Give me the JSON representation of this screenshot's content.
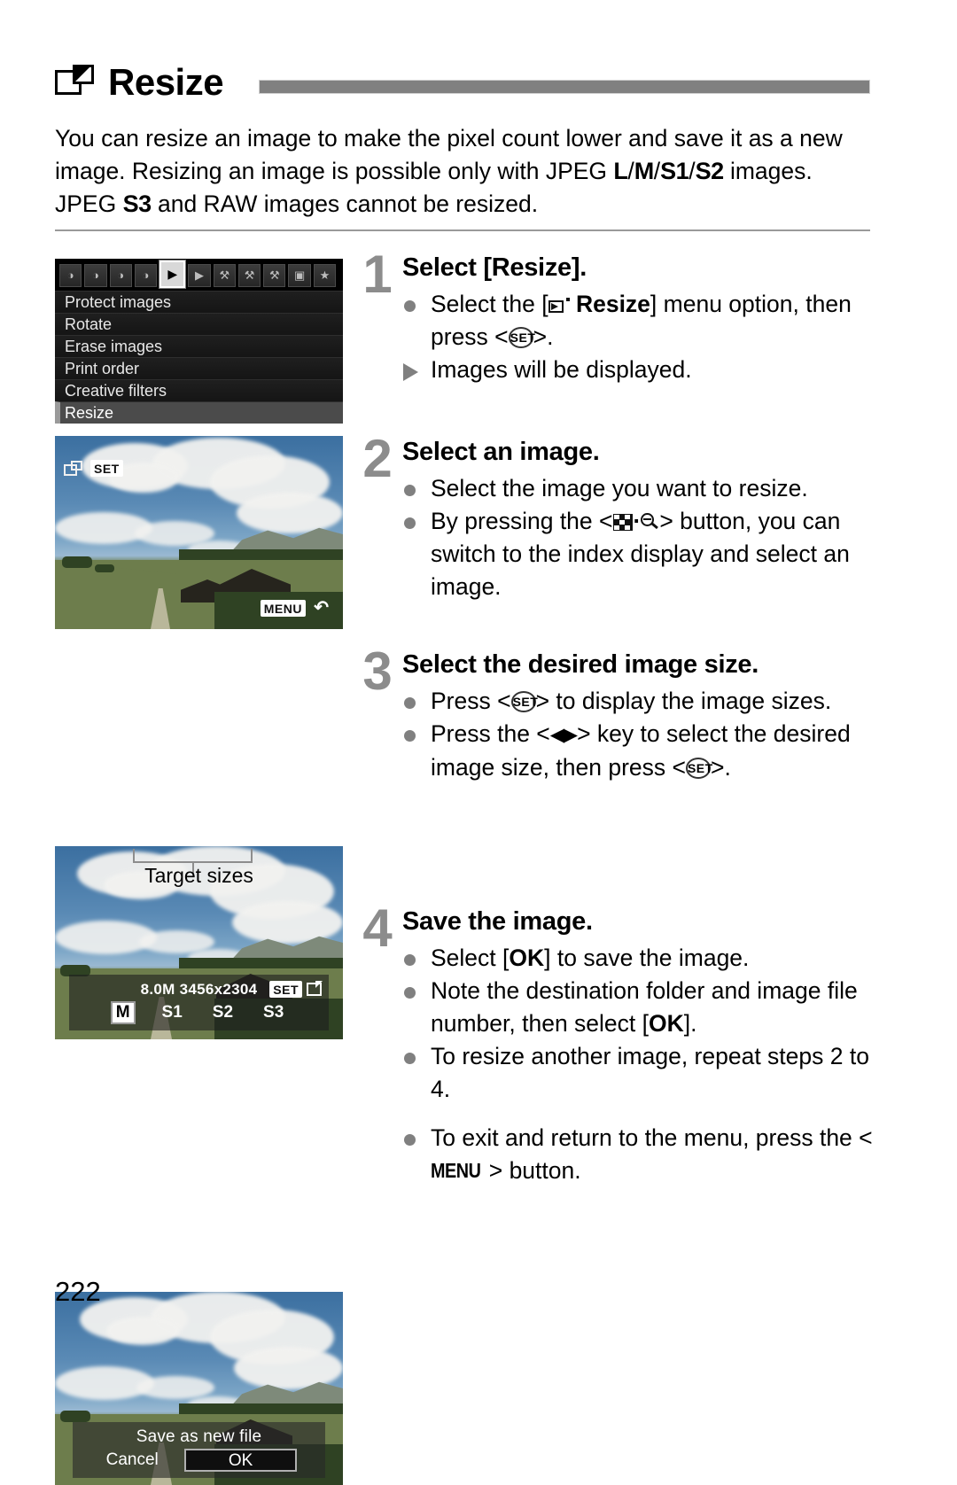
{
  "page": {
    "title": "Resize",
    "title_icon": "resize-icon",
    "number": "222",
    "intro_part1": "You can resize an image to make the pixel count lower and save it as a new image. Resizing an image is possible only with JPEG ",
    "intro_sizes_a": "L",
    "intro_sep1": "/",
    "intro_sizes_b": "M",
    "intro_sep2": "/",
    "intro_sizes_c": "S1",
    "intro_sep3": "/",
    "intro_sizes_d": "S2",
    "intro_part2": " images. JPEG ",
    "intro_sizes_e": "S3",
    "intro_part3": " and RAW images cannot be resized."
  },
  "menu_screen": {
    "tabs": [
      {
        "name": "shooting-tab-1",
        "glyph": "◑",
        "selected": false
      },
      {
        "name": "shooting-tab-2",
        "glyph": "◑",
        "selected": false
      },
      {
        "name": "shooting-tab-3",
        "glyph": "◑",
        "selected": false
      },
      {
        "name": "shooting-tab-4",
        "glyph": "◑",
        "selected": false
      },
      {
        "name": "playback-tab-1",
        "glyph": "▶",
        "selected": true
      },
      {
        "name": "playback-tab-2",
        "glyph": "▶",
        "selected": false
      },
      {
        "name": "setup-tab-1",
        "glyph": "⚒",
        "selected": false
      },
      {
        "name": "setup-tab-2",
        "glyph": "⚒",
        "selected": false
      },
      {
        "name": "setup-tab-3",
        "glyph": "⚒",
        "selected": false
      },
      {
        "name": "custom-functions-tab",
        "glyph": "▣",
        "selected": false
      },
      {
        "name": "my-menu-tab",
        "glyph": "★",
        "selected": false
      }
    ],
    "items": [
      {
        "label": "Protect images",
        "highlighted": false
      },
      {
        "label": "Rotate",
        "highlighted": false
      },
      {
        "label": "Erase images",
        "highlighted": false
      },
      {
        "label": "Print order",
        "highlighted": false
      },
      {
        "label": "Creative filters",
        "highlighted": false
      },
      {
        "label": "Resize",
        "highlighted": true
      }
    ]
  },
  "photo_select_screen": {
    "resize_icon": "resize-icon",
    "set_badge": "SET",
    "menu_badge": "MENU",
    "return_arrow": "↶"
  },
  "size_select_screen": {
    "megapixels": "8.0M",
    "dimensions": "3456x2304",
    "set_badge": "SET",
    "save_icon": "save-as-new-file-icon",
    "options": [
      {
        "label": "M",
        "selected": true
      },
      {
        "label": "S1",
        "selected": false
      },
      {
        "label": "S2",
        "selected": false
      },
      {
        "label": "S3",
        "selected": false
      }
    ],
    "caption": "Target sizes"
  },
  "save_dialog_screen": {
    "title": "Save as new file",
    "cancel_label": "Cancel",
    "ok_label": "OK"
  },
  "steps": [
    {
      "number": "1",
      "heading": "Select [Resize].",
      "bullets": [
        {
          "marker": "dot",
          "pre": "Select the [",
          "icon": "resize-icon",
          "bold": "Resize",
          "mid": "] menu option, then press <",
          "key": "SET",
          "post": ">."
        },
        {
          "marker": "triangle",
          "text": "Images will be displayed."
        }
      ]
    },
    {
      "number": "2",
      "heading": "Select an image.",
      "bullets": [
        {
          "marker": "dot",
          "text": "Select the image you want to resize."
        },
        {
          "marker": "dot",
          "pre": "By pressing the <",
          "icon": "index-magnify-icon",
          "post": "> button, you can switch to the index display and select an image."
        }
      ]
    },
    {
      "number": "3",
      "heading": "Select the desired image size.",
      "bullets": [
        {
          "marker": "dot",
          "pre": "Press <",
          "key": "SET",
          "post": "> to display the image sizes."
        },
        {
          "marker": "dot",
          "pre": "Press the <",
          "icon": "left-right-arrows-icon",
          "mid": "> key to select the desired image size, then press <",
          "key": "SET",
          "post": ">."
        }
      ]
    },
    {
      "number": "4",
      "heading": "Save the image.",
      "bullets": [
        {
          "marker": "dot",
          "pre": "Select [",
          "bold": "OK",
          "post": "] to save the image."
        },
        {
          "marker": "dot",
          "pre": "Note the destination folder and image file number, then select [",
          "bold": "OK",
          "post": "]."
        },
        {
          "marker": "dot",
          "text": "To resize another image, repeat steps 2 to 4."
        },
        {
          "marker": "dot",
          "pre": "To exit and return to the menu, press the <",
          "key": "MENU",
          "post": "> button."
        }
      ]
    }
  ]
}
